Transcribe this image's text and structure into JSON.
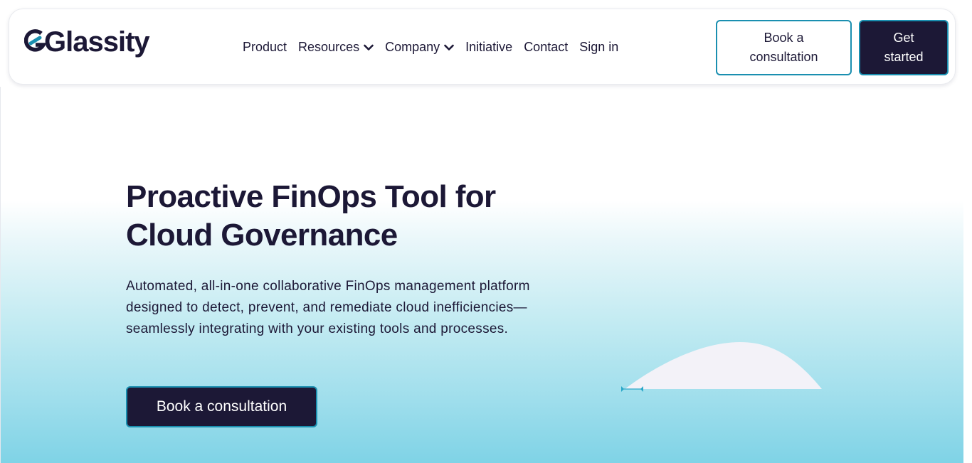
{
  "header": {
    "logo_text": "Glassity",
    "nav": [
      {
        "label": "Product",
        "has_dropdown": false
      },
      {
        "label": "Resources",
        "has_dropdown": true
      },
      {
        "label": "Company",
        "has_dropdown": true
      },
      {
        "label": "Initiative",
        "has_dropdown": false
      },
      {
        "label": "Contact",
        "has_dropdown": false
      },
      {
        "label": "Sign in",
        "has_dropdown": false
      }
    ],
    "book_consultation_label": "Book a consultation",
    "get_started_label": "Get started"
  },
  "hero": {
    "title": "Proactive FinOps Tool for Cloud Governance",
    "description": "Automated, all-in-one collaborative FinOps management platform designed to detect, prevent, and remediate cloud inefficiencies—seamlessly integrating with your existing tools and processes.",
    "cta_label": "Book a consultation"
  },
  "icons": {
    "logo": "glassity-logo-icon",
    "dropdown": "chevron-down-icon"
  },
  "colors": {
    "brand_dark": "#1c1836",
    "accent_teal": "#1a8fb0",
    "hero_gradient_end": "#7fd3e6"
  }
}
